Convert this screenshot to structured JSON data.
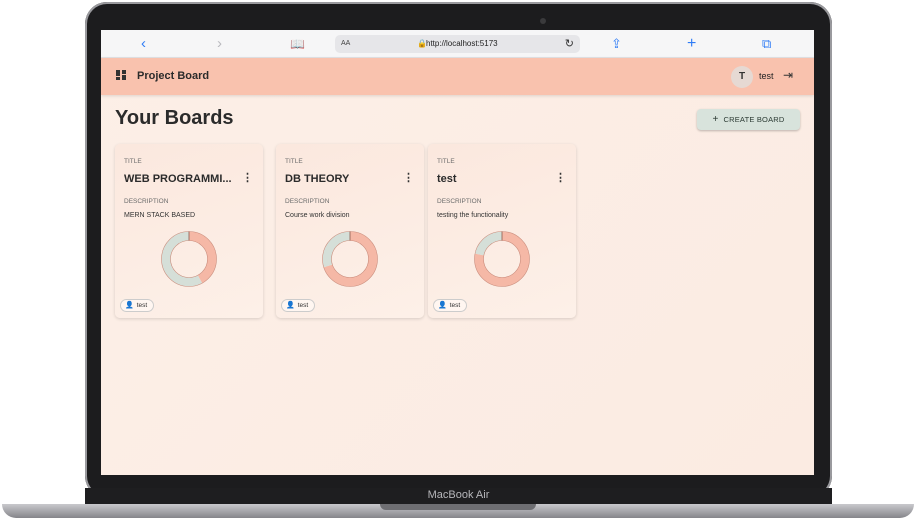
{
  "device": {
    "label": "MacBook Air"
  },
  "browser": {
    "text_size": "AA",
    "url": "http://localhost:5173",
    "icons": [
      "back-icon",
      "forward-icon",
      "bookmarks-icon",
      "lock-icon",
      "reload-icon",
      "share-icon",
      "new-tab-icon",
      "tabs-icon"
    ]
  },
  "appbar": {
    "title": "Project Board",
    "avatar_initial": "T",
    "username": "test"
  },
  "main": {
    "heading": "Your Boards",
    "create_label": "CREATE BOARD"
  },
  "labels": {
    "title": "TITLE",
    "description": "DESCRIPTION"
  },
  "colors": {
    "appbar": "#f9c2ae",
    "donut_a": "#f5b8a6",
    "donut_b": "#d5dfd8",
    "button": "#d8e3dc"
  },
  "boards": [
    {
      "title": "WEB PROGRAMMI...",
      "description": "MERN STACK BASED",
      "member": "test",
      "ring_fraction_a": 0.42
    },
    {
      "title": "DB THEORY",
      "description": "Course work division",
      "member": "test",
      "ring_fraction_a": 0.7
    },
    {
      "title": "test",
      "description": "testing the functionality",
      "member": "test",
      "ring_fraction_a": 0.78
    }
  ]
}
